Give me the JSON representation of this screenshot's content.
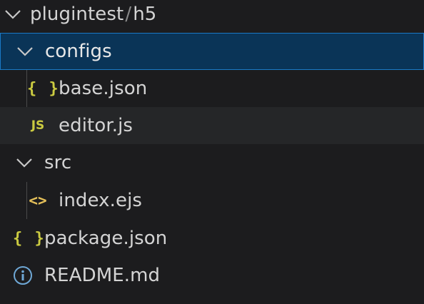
{
  "explorer": {
    "root": {
      "parent": "plugintest",
      "separator": "/",
      "name": "h5"
    },
    "items": [
      {
        "label": "configs",
        "kind": "folder",
        "expanded": true,
        "selected": true
      },
      {
        "label": "base.json",
        "kind": "file",
        "icon": "json-braces-icon"
      },
      {
        "label": "editor.js",
        "kind": "file",
        "icon": "js-icon"
      },
      {
        "label": "src",
        "kind": "folder",
        "expanded": true
      },
      {
        "label": "index.ejs",
        "kind": "file",
        "icon": "code-brackets-icon"
      },
      {
        "label": "package.json",
        "kind": "file",
        "icon": "json-braces-icon"
      },
      {
        "label": "README.md",
        "kind": "file",
        "icon": "info-icon"
      }
    ],
    "icons": {
      "json": "{ }",
      "js": "JS",
      "code": "<>"
    }
  },
  "colors": {
    "background": "#1c1c1e",
    "selection_bg": "#0a3457",
    "selection_border": "#1a79c6",
    "hover_bg": "#252628",
    "icon_yellow": "#cbcb41",
    "text": "#d4d4d4"
  }
}
